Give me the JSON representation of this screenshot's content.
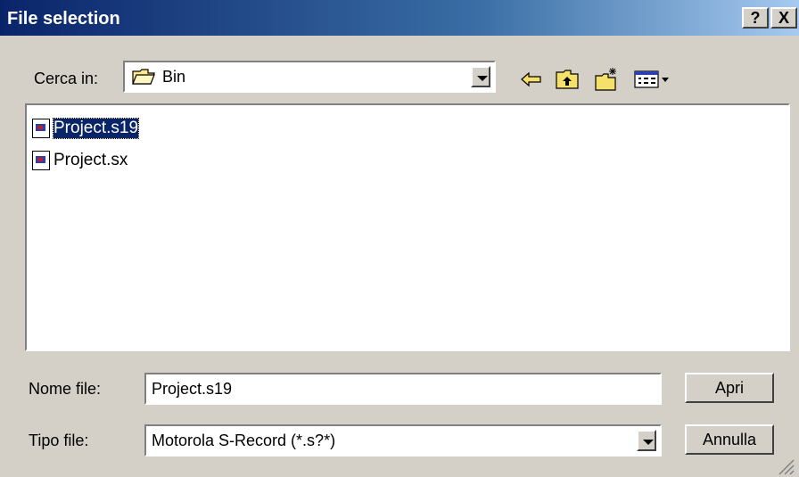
{
  "window": {
    "title": "File selection",
    "help": "?",
    "close": "X"
  },
  "look_in": {
    "label": "Cerca in:",
    "value": "Bin"
  },
  "files": [
    {
      "name": "Project.s19",
      "selected": true
    },
    {
      "name": "Project.sx",
      "selected": false
    }
  ],
  "filename": {
    "label": "Nome file:",
    "value": "Project.s19"
  },
  "filetype": {
    "label": "Tipo file:",
    "value": "Motorola S-Record (*.s?*)"
  },
  "buttons": {
    "open": "Apri",
    "cancel": "Annulla"
  },
  "toolbar": {
    "icons": [
      "back-icon",
      "up-folder-icon",
      "new-folder-icon",
      "view-menu-icon"
    ]
  },
  "colors": {
    "title_start": "#0a246a",
    "title_end": "#a6caf0",
    "selection": "#0a246a"
  }
}
